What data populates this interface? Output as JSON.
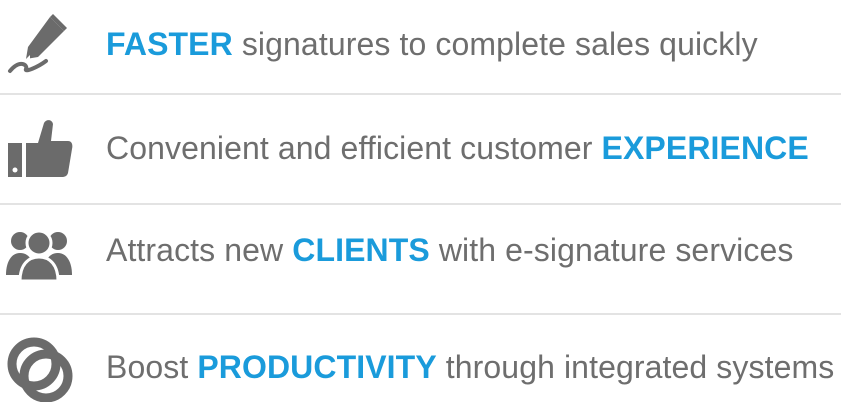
{
  "colors": {
    "highlight": "#1a9bdb",
    "text": "#6e6e6e",
    "icon": "#6b6b6b",
    "divider": "#e3e3e3"
  },
  "items": [
    {
      "icon": "pen-signature-icon",
      "before": "",
      "highlight": "FASTER",
      "after": " signatures to complete sales quickly"
    },
    {
      "icon": "thumbs-up-icon",
      "before": "Convenient and efficient customer ",
      "highlight": "EXPERIENCE",
      "after": ""
    },
    {
      "icon": "people-group-icon",
      "before": "Attracts new ",
      "highlight": "CLIENTS",
      "after": " with e-signature services"
    },
    {
      "icon": "linked-circles-icon",
      "before": "Boost ",
      "highlight": "PRODUCTIVITY",
      "after": " through integrated systems"
    }
  ]
}
